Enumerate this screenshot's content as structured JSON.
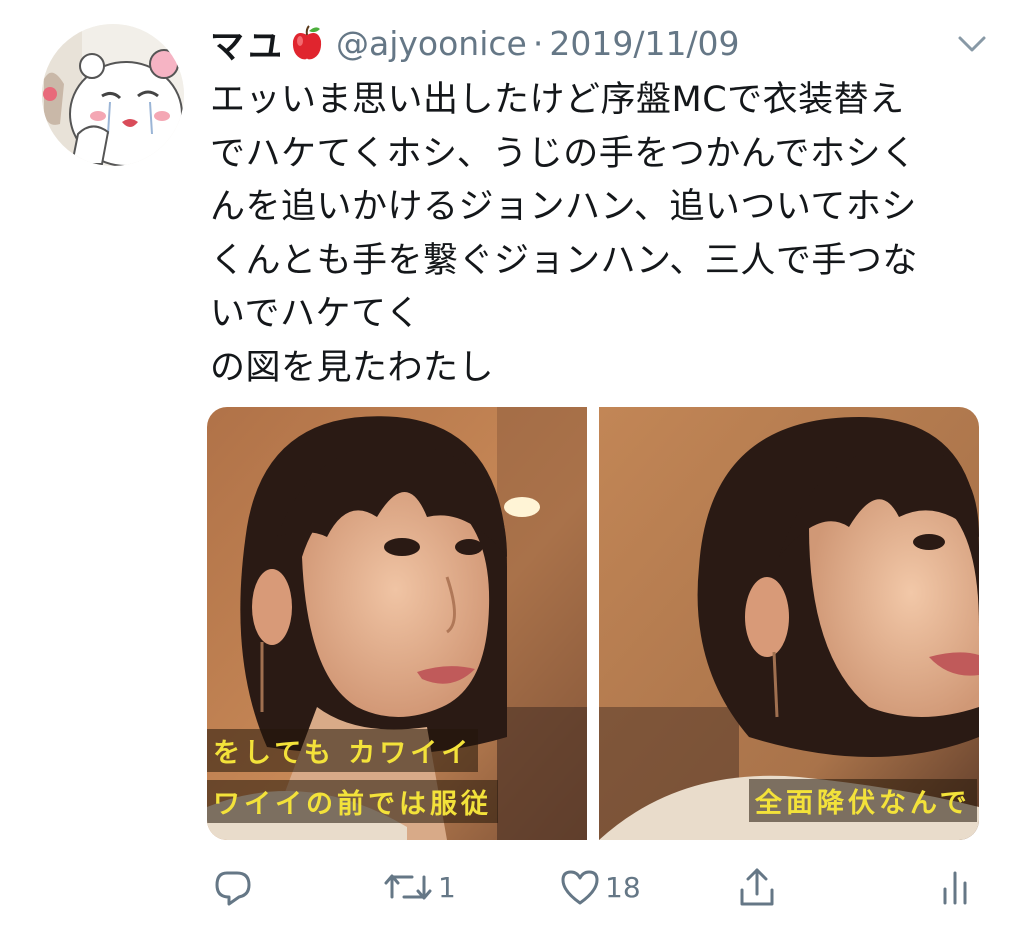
{
  "tweet": {
    "display_name": "マユ",
    "name_emoji": "red-apple-icon",
    "handle": "@ajyoonice",
    "separator": "·",
    "date": "2019/11/09",
    "text_lines": [
      "エッいま思い出したけど序盤MCで衣装替え",
      "でハケてくホシ、うじの手をつかんでホシく",
      "んを追いかけるジョンハン、追いついてホシ",
      "くんとも手を繋ぐジョンハン、三人で手つな",
      "いでハケてく",
      "の図を見たわたし"
    ],
    "media": {
      "left_subtitles": [
        "をしても カワイイ",
        "ワイイの前では服従"
      ],
      "right_subtitles": [
        "全面降伏なんで"
      ]
    },
    "actions": {
      "reply_count": "",
      "retweet_count": "1",
      "like_count": "18"
    }
  },
  "colors": {
    "text": "#14171a",
    "secondary": "#657786",
    "subtitle": "#f3e23a",
    "apple": "#e0252e"
  }
}
